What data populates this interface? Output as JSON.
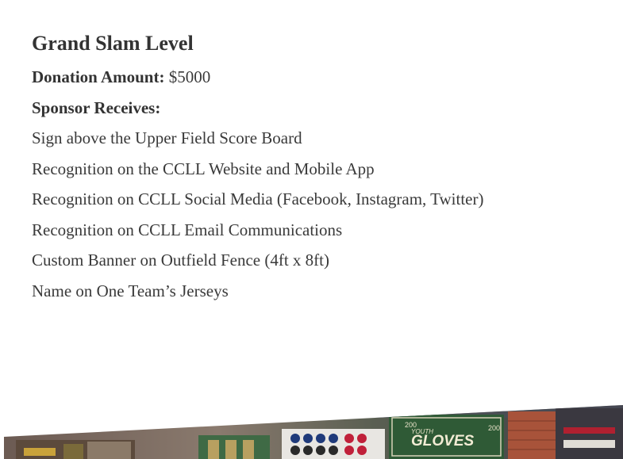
{
  "level": {
    "title": "Grand Slam Level",
    "donation_label": "Donation Amount:",
    "donation_value": "$5000",
    "receives_label": "Sponsor Receives:"
  },
  "benefits": [
    "Sign above the Upper Field Score Board",
    "Recognition on the CCLL Website and Mobile App",
    "Recognition on CCLL Social Media (Facebook, Instagram, Twitter)",
    "Recognition on CCLL Email Communications",
    "Custom Banner on Outfield Fence (4ft x 8ft)",
    "Name on One Team’s Jerseys"
  ],
  "photo": {
    "sign_text": "GLOVES",
    "sign_small_left": "200",
    "sign_small_right": "200",
    "sign_caption": "YOUTH",
    "icon": "store-photo-banner"
  }
}
